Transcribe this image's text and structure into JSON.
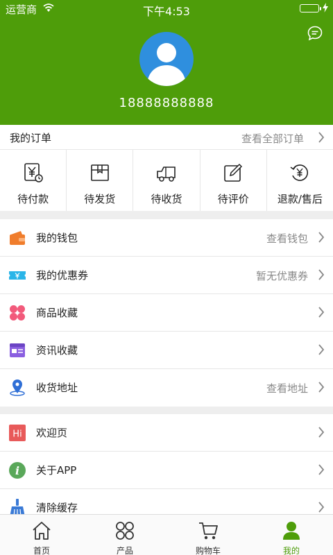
{
  "status_bar": {
    "carrier": "运营商",
    "time": "下午4:53"
  },
  "profile": {
    "phone": "18888888888"
  },
  "orders": {
    "title": "我的订单",
    "view_all": "查看全部订单",
    "items": [
      {
        "label": "待付款",
        "icon": "pending-payment-icon"
      },
      {
        "label": "待发货",
        "icon": "pending-shipment-icon"
      },
      {
        "label": "待收货",
        "icon": "pending-receipt-icon"
      },
      {
        "label": "待评价",
        "icon": "pending-review-icon"
      },
      {
        "label": "退款/售后",
        "icon": "refund-icon"
      }
    ]
  },
  "menu_group_1": [
    {
      "label": "我的钱包",
      "extra": "查看钱包",
      "icon": "wallet-icon",
      "color": "#f07d2c"
    },
    {
      "label": "我的优惠券",
      "extra": "暂无优惠券",
      "icon": "coupon-icon",
      "color": "#2bb5e8"
    },
    {
      "label": "商品收藏",
      "extra": "",
      "icon": "favorite-goods-icon",
      "color": "#f25a7b"
    },
    {
      "label": "资讯收藏",
      "extra": "",
      "icon": "news-favorite-icon",
      "color": "#8a5fe0"
    },
    {
      "label": "收货地址",
      "extra": "查看地址",
      "icon": "location-icon",
      "color": "#2f6fd6"
    }
  ],
  "menu_group_2": [
    {
      "label": "欢迎页",
      "extra": "",
      "icon": "welcome-icon",
      "icon_text": "Hi",
      "color": "#e85a5a"
    },
    {
      "label": "关于APP",
      "extra": "",
      "icon": "info-icon",
      "icon_text": "i",
      "color": "#5aa85a"
    },
    {
      "label": "清除缓存",
      "extra": "",
      "icon": "broom-icon",
      "color": "#3a7ad6"
    }
  ],
  "tabbar": [
    {
      "label": "首页",
      "icon": "home-icon",
      "active": false
    },
    {
      "label": "产品",
      "icon": "products-icon",
      "active": false
    },
    {
      "label": "购物车",
      "icon": "cart-icon",
      "active": false
    },
    {
      "label": "我的",
      "icon": "profile-icon",
      "active": true
    }
  ],
  "colors": {
    "primary": "#4e9d0a",
    "avatar_bg": "#2f8fde",
    "muted_text": "#888888"
  }
}
